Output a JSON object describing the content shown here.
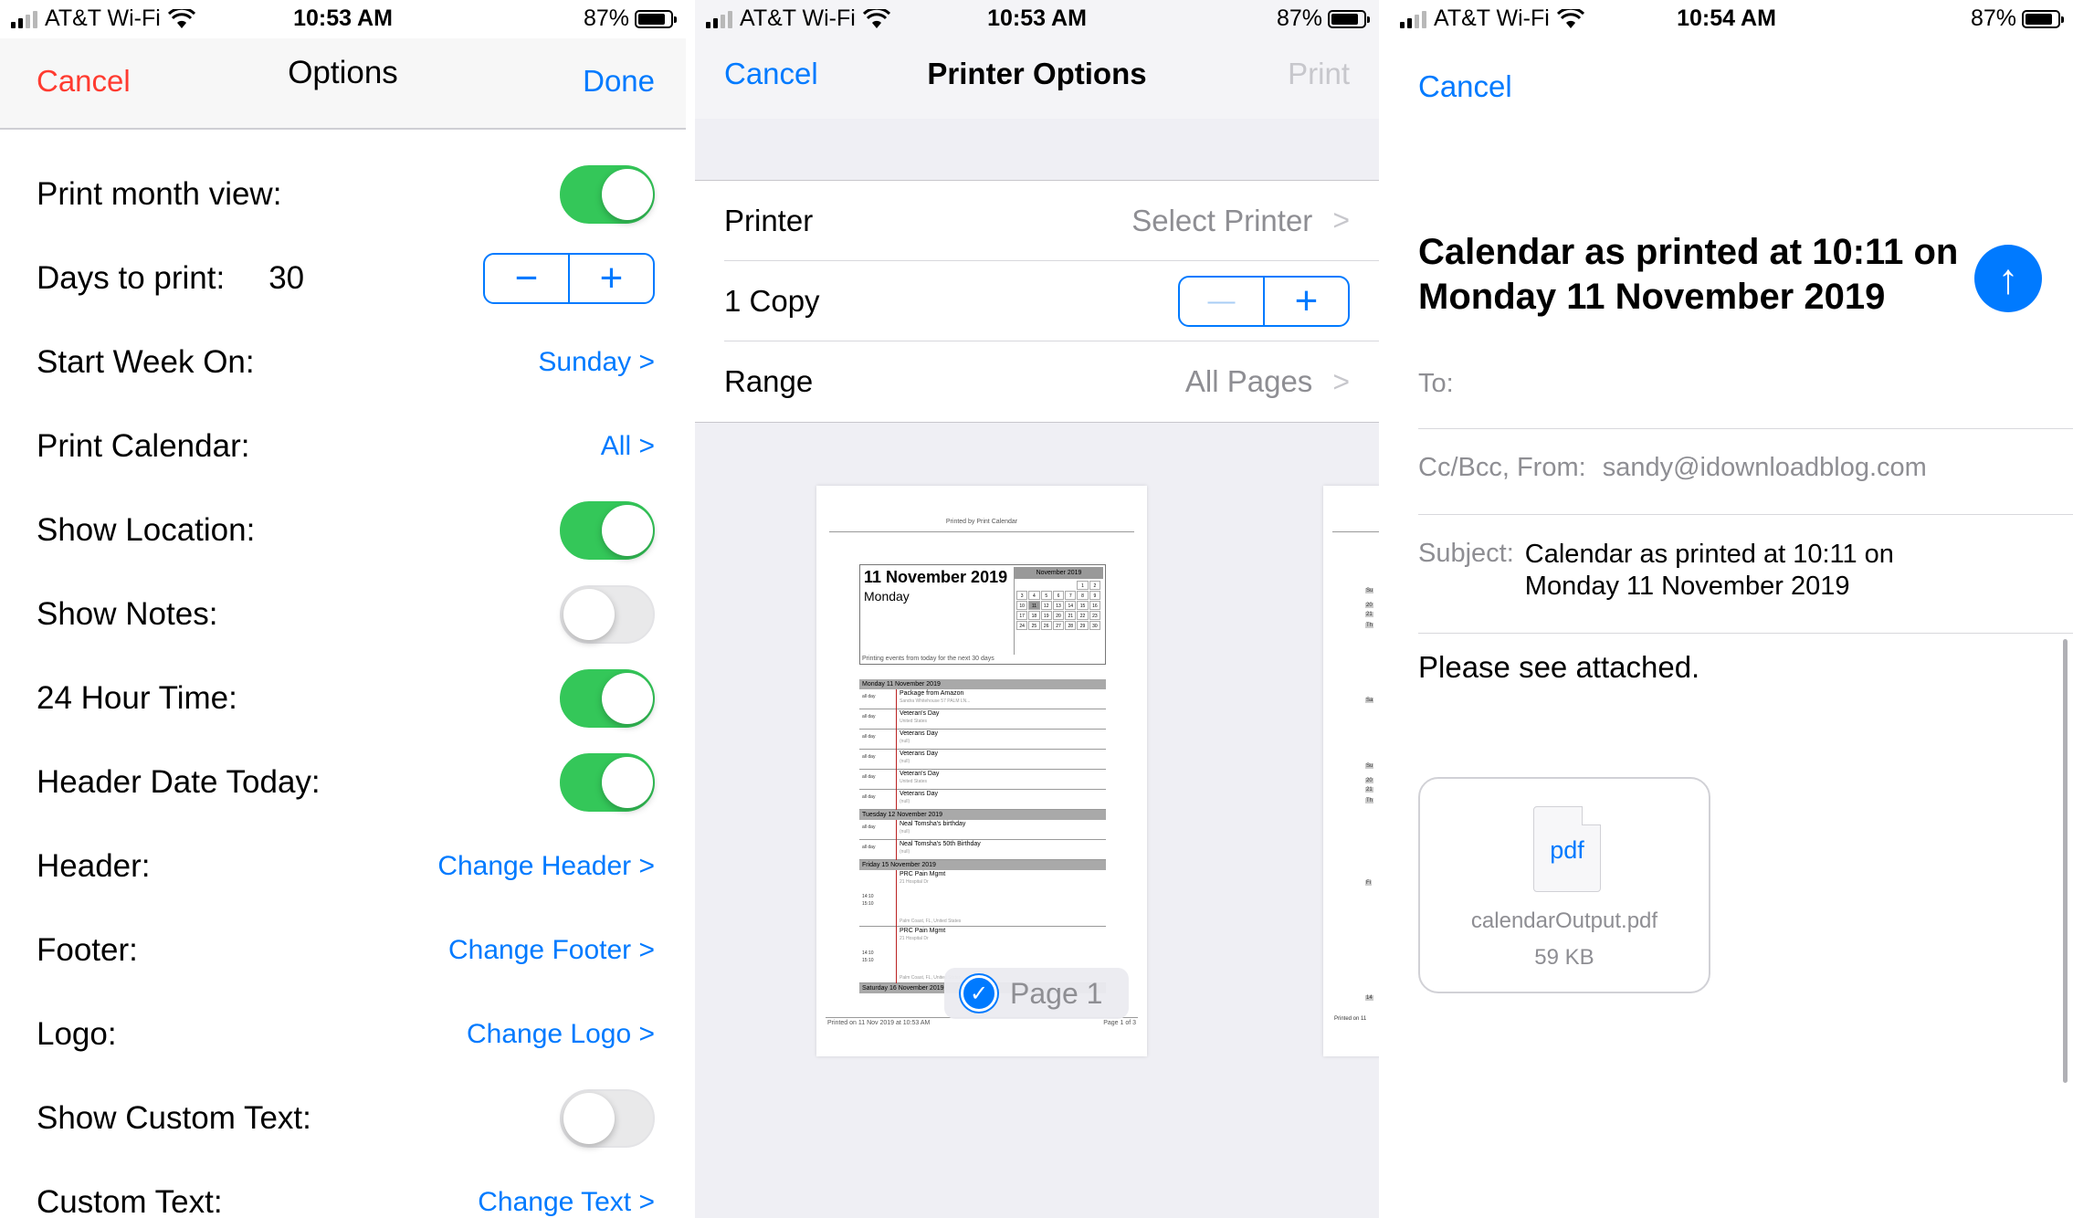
{
  "status_bars": [
    {
      "carrier": "AT&T Wi-Fi",
      "time": "10:53 AM",
      "battery": "87%"
    },
    {
      "carrier": "AT&T Wi-Fi",
      "time": "10:53 AM",
      "battery": "87%"
    },
    {
      "carrier": "AT&T Wi-Fi",
      "time": "10:54 AM",
      "battery": "87%"
    }
  ],
  "options": {
    "nav": {
      "cancel": "Cancel",
      "title": "Options",
      "done": "Done"
    },
    "print_month_view": {
      "label": "Print month view:",
      "on": true
    },
    "days_to_print": {
      "label": "Days to print:",
      "value": "30",
      "minus": "−",
      "plus": "+"
    },
    "start_week_on": {
      "label": "Start Week On:",
      "value": "Sunday >"
    },
    "print_calendar": {
      "label": "Print Calendar:",
      "value": "All >"
    },
    "show_location": {
      "label": "Show Location:",
      "on": true
    },
    "show_notes": {
      "label": "Show Notes:",
      "on": false
    },
    "hour24": {
      "label": "24 Hour Time:",
      "on": true
    },
    "header_date_today": {
      "label": "Header Date Today:",
      "on": true
    },
    "header": {
      "label": "Header:",
      "value": "Change Header >"
    },
    "footer": {
      "label": "Footer:",
      "value": "Change Footer >"
    },
    "logo": {
      "label": "Logo:",
      "value": "Change Logo >"
    },
    "show_custom_text": {
      "label": "Show Custom Text:",
      "on": false
    },
    "custom_text": {
      "label": "Custom Text:",
      "value": "Change Text >"
    }
  },
  "printer": {
    "nav": {
      "cancel": "Cancel",
      "title": "Printer Options",
      "print": "Print"
    },
    "printer_row": {
      "label": "Printer",
      "value": "Select Printer"
    },
    "copy_row": {
      "label": "1 Copy",
      "minus": "—",
      "plus": "+"
    },
    "range_row": {
      "label": "Range",
      "value": "All Pages"
    },
    "chevron": ">",
    "preview": {
      "printed_by": "Printed by Print Calendar",
      "date_title": "11 November 2019",
      "weekday": "Monday",
      "events_note": "Printing events from today for the next 30 days",
      "mini_month": "November 2019",
      "mini_days": [
        "",
        "",
        "",
        "",
        "",
        "1",
        "2",
        "3",
        "4",
        "5",
        "6",
        "7",
        "8",
        "9",
        "10",
        "11",
        "12",
        "13",
        "14",
        "15",
        "16",
        "17",
        "18",
        "19",
        "20",
        "21",
        "22",
        "23",
        "24",
        "25",
        "26",
        "27",
        "28",
        "29",
        "30"
      ],
      "days": [
        {
          "heading": "Monday 11 November 2019",
          "events": [
            {
              "time": "all day",
              "title": "Package from Amazon",
              "sub": "Sandra Whitehouse 57 PALM LN..."
            },
            {
              "time": "all day",
              "title": "Veteran's Day",
              "sub": "United States"
            },
            {
              "time": "all day",
              "title": "Veterans Day",
              "sub": "(null)"
            },
            {
              "time": "all day",
              "title": "Veterans Day",
              "sub": "(null)"
            },
            {
              "time": "all day",
              "title": "Veteran's Day",
              "sub": "United States"
            },
            {
              "time": "all day",
              "title": "Veterans Day",
              "sub": "(null)"
            }
          ]
        },
        {
          "heading": "Tuesday 12 November 2019",
          "events": [
            {
              "time": "all day",
              "title": "Neal Tomsha's birthday",
              "sub": "(null)"
            },
            {
              "time": "all day",
              "title": "Neal Tomsha's 50th Birthday",
              "sub": "(null)"
            }
          ]
        },
        {
          "heading": "Friday 15 November 2019",
          "events": [
            {
              "time": "14:10",
              "time2": "15:10",
              "title": "PRC Pain Mgmt",
              "sub": "21 Hospital Dr",
              "sub2": "Palm Coast, FL, United States"
            },
            {
              "time": "14:10",
              "time2": "15:10",
              "title": "PRC Pain Mgmt",
              "sub": "21 Hospital Dr",
              "sub2": "Palm Coast, FL, United States"
            }
          ]
        },
        {
          "heading": "Saturday 16 November 2019",
          "events": []
        }
      ],
      "footer_left": "Printed on 11 Nov 2019 at 10:53 AM",
      "footer_right": "Page 1 of 3",
      "second_page_labels": [
        "Su",
        "20",
        "21",
        "Th",
        "Sa",
        "Su",
        "20",
        "21",
        "Th",
        "Fi",
        "14",
        "Printed on 11"
      ]
    },
    "page_badge": "Page 1"
  },
  "mail": {
    "cancel": "Cancel",
    "title": "Calendar as printed at 10:11 on Monday 11 November 2019",
    "to_label": "To:",
    "ccbcc_label": "Cc/Bcc, From:",
    "from": "sandy@idownloadblog.com",
    "subject_label": "Subject:",
    "subject_line1": "Calendar as printed at 10:11 on",
    "subject_line2": "Monday 11 November 2019",
    "body": "Please see attached.",
    "attachment": {
      "type": "pdf",
      "name": "calendarOutput.pdf",
      "size": "59 KB"
    }
  },
  "colors": {
    "accent": "#007aff",
    "destructive": "#ff3b30",
    "toggle_on": "#34c759"
  }
}
